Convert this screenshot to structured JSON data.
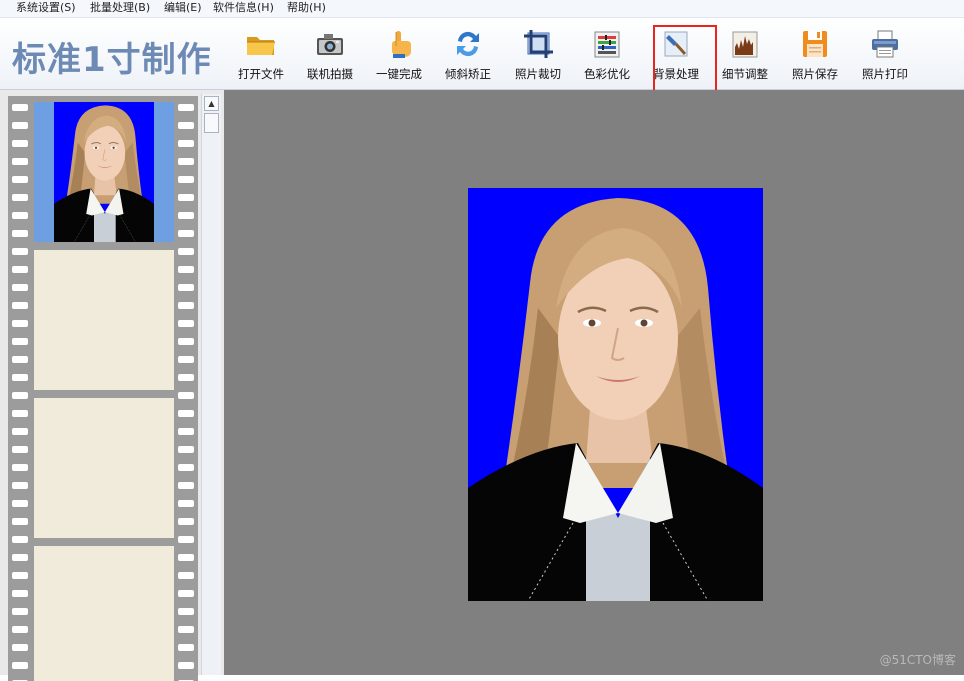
{
  "menu": [
    "系统设置(S)",
    "批量处理(B)",
    "编辑(E)",
    "软件信息(H)",
    "帮助(H)"
  ],
  "app_title": "标准1寸制作",
  "toolbar": [
    {
      "label": "打开文件",
      "icon": "folder-icon"
    },
    {
      "label": "联机拍摄",
      "icon": "camera-icon"
    },
    {
      "label": "一键完成",
      "icon": "hand-pointer-icon"
    },
    {
      "label": "倾斜矫正",
      "icon": "rotate-arrows-icon"
    },
    {
      "label": "照片裁切",
      "icon": "crop-icon"
    },
    {
      "label": "色彩优化",
      "icon": "color-levels-icon"
    },
    {
      "label": "背景处理",
      "icon": "brush-icon"
    },
    {
      "label": "细节调整",
      "icon": "histogram-icon"
    },
    {
      "label": "照片保存",
      "icon": "floppy-disk-icon"
    },
    {
      "label": "照片打印",
      "icon": "printer-icon"
    }
  ],
  "highlighted_tool": "背景处理",
  "colors": {
    "photo_background": "#0000ff",
    "highlight": "#e8261d",
    "title": "#6d8ab4",
    "canvas": "#808080",
    "film": "#9c9c9c"
  },
  "filmstrip": {
    "frames": 4,
    "selected_index": 0
  },
  "watermark": "@51CTO博客"
}
